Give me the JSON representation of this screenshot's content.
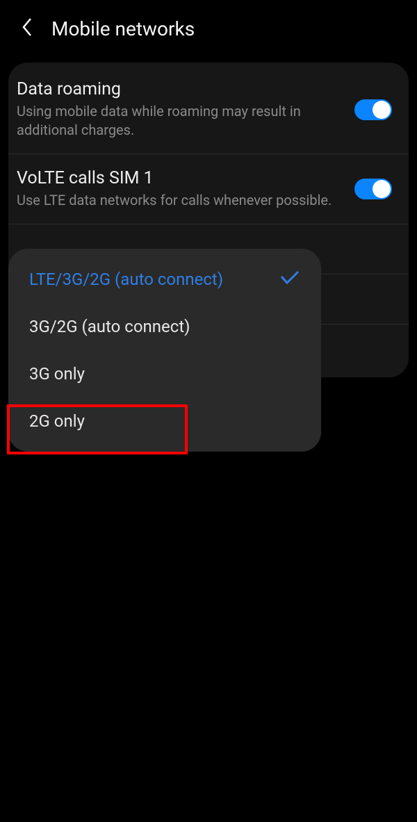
{
  "header": {
    "title": "Mobile networks"
  },
  "settings": {
    "dataRoaming": {
      "title": "Data roaming",
      "description": "Using mobile data while roaming may result in additional charges.",
      "enabled": true
    },
    "volte": {
      "title": "VoLTE calls SIM 1",
      "description": "Use LTE data networks for calls whenever possible.",
      "enabled": true
    }
  },
  "dropdown": {
    "options": [
      {
        "label": "LTE/3G/2G (auto connect)",
        "selected": true
      },
      {
        "label": "3G/2G (auto connect)",
        "selected": false
      },
      {
        "label": "3G only",
        "selected": false
      },
      {
        "label": "2G only",
        "selected": false
      }
    ]
  },
  "colors": {
    "accent": "#0b84ff",
    "selected": "#2f7fe6",
    "highlight": "#ff0000"
  }
}
